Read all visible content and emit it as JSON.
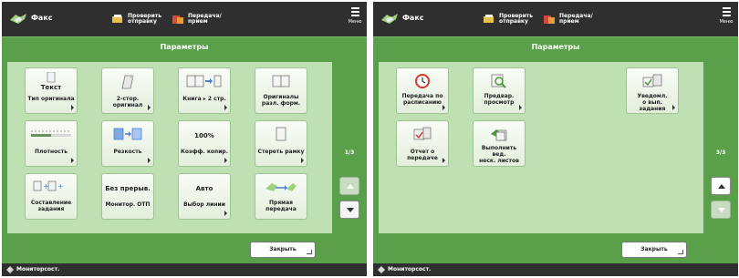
{
  "header": {
    "fax_label": "Факс",
    "button1_label": "Проверить\nотправку",
    "button2_label": "Передача/\nприем",
    "menu_label": "Меню"
  },
  "screens": [
    {
      "title": "Параметры",
      "page_indicator": "1/3",
      "close_label": "Закрыть",
      "status_label": "Мониторсост.",
      "items": [
        {
          "value": "Текст",
          "label": "Тип оригинала"
        },
        {
          "value": "",
          "label": "2-стор. оригинал"
        },
        {
          "value": "",
          "label": "Книга ▸ 2 стр."
        },
        {
          "value": "",
          "label": "Оригиналы\nразл. форм."
        },
        {
          "value": "",
          "label": "Плотность"
        },
        {
          "value": "",
          "label": "Резкость"
        },
        {
          "value": "100%",
          "label": "Коэфф. копир."
        },
        {
          "value": "",
          "label": "Стереть рамку"
        },
        {
          "value": "",
          "label": "Составление\nзадания"
        },
        {
          "value": "Без прерыв.",
          "label": "Монитор. ОТП"
        },
        {
          "value": "Авто",
          "label": "Выбор линии"
        },
        {
          "value": "",
          "label": "Прямая\nпередача"
        }
      ]
    },
    {
      "title": "Параметры",
      "page_indicator": "3/3",
      "close_label": "Закрыть",
      "status_label": "Мониторсост.",
      "items": [
        {
          "label": "Передача по\nрасписанию"
        },
        {
          "label": "Предвар.\nпросмотр"
        },
        {
          "label": "Уведомл.\nо вып. задания"
        },
        {
          "label": "Отчет о передаче"
        },
        {
          "label": "Выполнить вед.\nнеск. листов"
        }
      ]
    }
  ],
  "colors": {
    "dark_bar": "#2f2f2f",
    "green": "#5aa04a",
    "panel": "#bfe0b3"
  }
}
